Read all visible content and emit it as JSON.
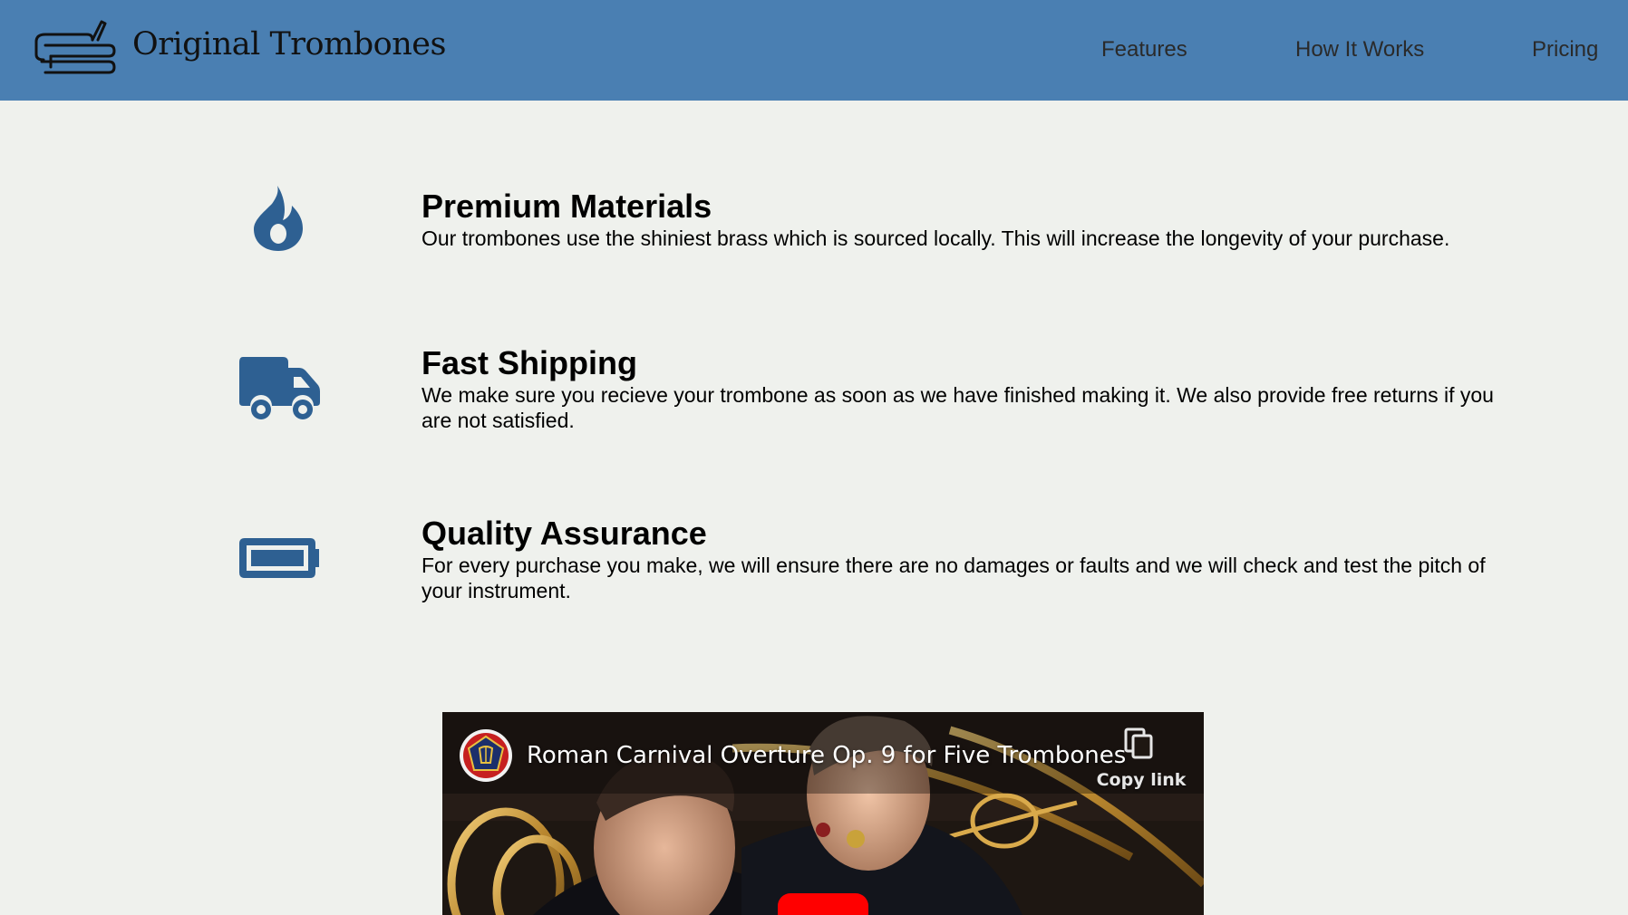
{
  "header": {
    "brand": "Original Trombones",
    "logo_icon": "trombone-icon",
    "nav": [
      {
        "label": "Features"
      },
      {
        "label": "How It Works"
      },
      {
        "label": "Pricing"
      }
    ],
    "background_color": "#4a7fb2"
  },
  "features": [
    {
      "icon": "fire-icon",
      "title": "Premium Materials",
      "description": "Our trombones use the shiniest brass which is sourced locally. This will increase the longevity of your purchase."
    },
    {
      "icon": "truck-icon",
      "title": "Fast Shipping",
      "description": "We make sure you recieve your trombone as soon as we have finished making it. We also provide free returns if you are not satisfied."
    },
    {
      "icon": "battery-full-icon",
      "title": "Quality Assurance",
      "description": "For every purchase you make, we will ensure there are no damages or faults and we will check and test the pitch of your instrument."
    }
  ],
  "video": {
    "title": "Roman Carnival Overture Op. 9 for Five Trombones",
    "copy_link_label": "Copy link",
    "play_button_color": "#ff0000"
  },
  "colors": {
    "page_background": "#eff1ed",
    "icon_color": "#2e6092"
  }
}
